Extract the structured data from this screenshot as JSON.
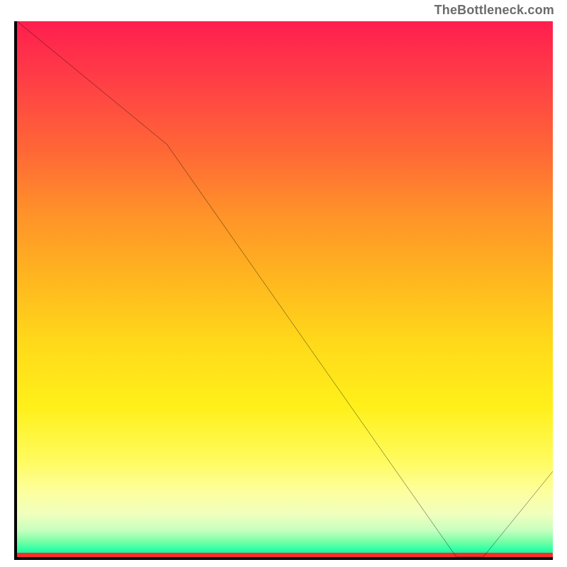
{
  "attribution": "TheBottleneck.com",
  "watermark_text": "",
  "chart_data": {
    "type": "line",
    "title": "",
    "xlabel": "",
    "ylabel": "",
    "xlim": [
      0,
      100
    ],
    "ylim": [
      0,
      100
    ],
    "series": [
      {
        "name": "curve",
        "x": [
          0,
          28,
          82,
          87,
          100
        ],
        "values": [
          100,
          77,
          0,
          0,
          16
        ]
      }
    ],
    "gradient_stops": [
      {
        "pct": 0,
        "color": "#ff1e4e"
      },
      {
        "pct": 10,
        "color": "#ff3b47"
      },
      {
        "pct": 25,
        "color": "#ff6a35"
      },
      {
        "pct": 35,
        "color": "#ff8f2a"
      },
      {
        "pct": 48,
        "color": "#ffb61f"
      },
      {
        "pct": 60,
        "color": "#ffd91a"
      },
      {
        "pct": 72,
        "color": "#fff01a"
      },
      {
        "pct": 82,
        "color": "#fffb5e"
      },
      {
        "pct": 88,
        "color": "#fdffa0"
      },
      {
        "pct": 92,
        "color": "#f0ffbd"
      },
      {
        "pct": 95,
        "color": "#c7ffbf"
      },
      {
        "pct": 97,
        "color": "#7bffa7"
      },
      {
        "pct": 99,
        "color": "#1affa4"
      },
      {
        "pct": 100,
        "color": "#ff2a2a"
      }
    ],
    "watermark_x_pct": 81
  }
}
